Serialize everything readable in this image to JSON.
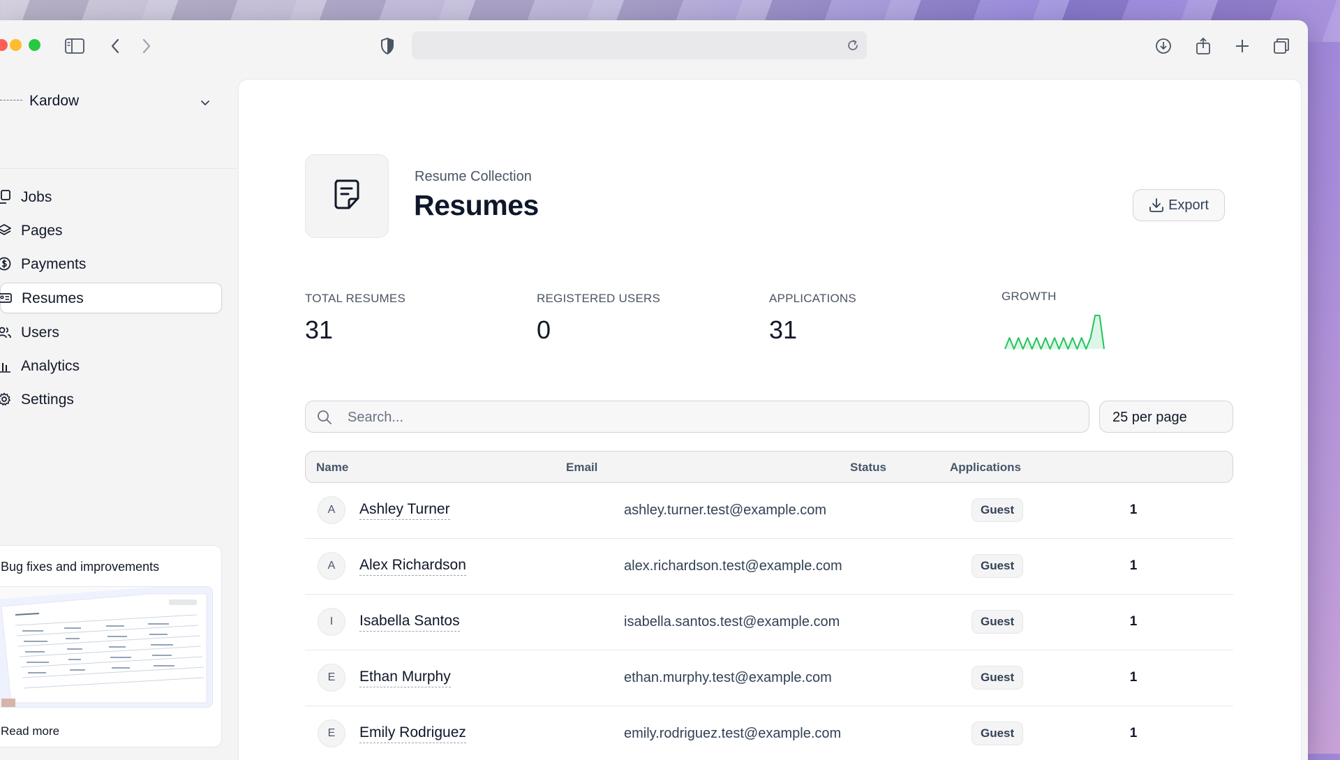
{
  "org": {
    "name": "Kardow"
  },
  "sidebar": {
    "items": [
      {
        "label": "Jobs",
        "icon": "copy-icon"
      },
      {
        "label": "Pages",
        "icon": "layers-icon"
      },
      {
        "label": "Payments",
        "icon": "dollar-circle-icon"
      },
      {
        "label": "Resumes",
        "icon": "id-card-icon",
        "active": true
      },
      {
        "label": "Users",
        "icon": "users-icon"
      },
      {
        "label": "Analytics",
        "icon": "bar-chart-icon"
      },
      {
        "label": "Settings",
        "icon": "gear-icon"
      }
    ],
    "whats_new": {
      "title": "Bug fixes and improvements",
      "read_more": "Read more"
    }
  },
  "header": {
    "subtitle": "Resume Collection",
    "title": "Resumes",
    "export_label": "Export"
  },
  "stats": [
    {
      "label": "TOTAL RESUMES",
      "value": "31"
    },
    {
      "label": "REGISTERED USERS",
      "value": "0"
    },
    {
      "label": "APPLICATIONS",
      "value": "31"
    },
    {
      "label": "GROWTH",
      "value": ""
    }
  ],
  "chart_data": {
    "type": "area",
    "x": [
      1,
      2,
      3,
      4,
      5,
      6,
      7,
      8,
      9,
      10,
      11,
      12,
      13,
      14,
      15,
      16,
      17,
      18,
      19,
      20,
      21,
      22,
      23
    ],
    "values": [
      0,
      1,
      0,
      1,
      0,
      1,
      0,
      1,
      0,
      1,
      0,
      1,
      0,
      1,
      0,
      1,
      0,
      1,
      0,
      1,
      3,
      3,
      0
    ],
    "ylim": [
      0,
      3
    ],
    "title": "",
    "xlabel": "",
    "ylabel": "",
    "color": "#22c55e"
  },
  "search": {
    "placeholder": "Search...",
    "value": ""
  },
  "per_page": {
    "selected": "25 per page"
  },
  "table": {
    "columns": [
      "Name",
      "Email",
      "Status",
      "Applications"
    ],
    "rows": [
      {
        "initial": "A",
        "name": "Ashley Turner",
        "email": "ashley.turner.test@example.com",
        "status": "Guest",
        "applications": "1"
      },
      {
        "initial": "A",
        "name": "Alex Richardson",
        "email": "alex.richardson.test@example.com",
        "status": "Guest",
        "applications": "1"
      },
      {
        "initial": "I",
        "name": "Isabella Santos",
        "email": "isabella.santos.test@example.com",
        "status": "Guest",
        "applications": "1"
      },
      {
        "initial": "E",
        "name": "Ethan Murphy",
        "email": "ethan.murphy.test@example.com",
        "status": "Guest",
        "applications": "1"
      },
      {
        "initial": "E",
        "name": "Emily Rodriguez",
        "email": "emily.rodriguez.test@example.com",
        "status": "Guest",
        "applications": "1"
      }
    ]
  },
  "colors": {
    "accent": "#22c55e",
    "active_bg": "#ffffff",
    "text": "#0f172a"
  }
}
